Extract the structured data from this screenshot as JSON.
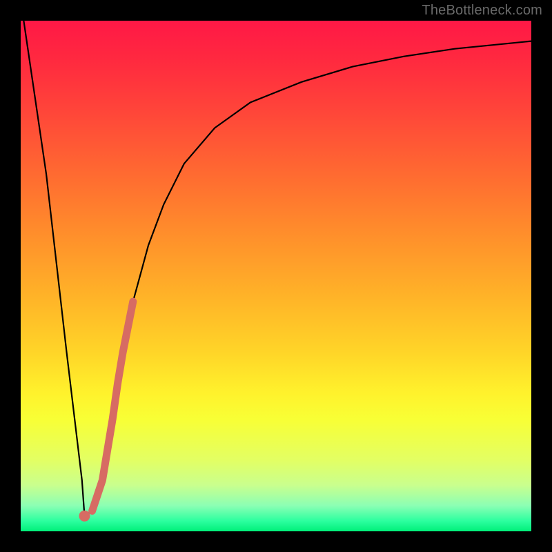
{
  "watermark": "TheBottleneck.com",
  "colors": {
    "frame": "#000000",
    "accent_segment": "#d76b63",
    "curve": "#000000"
  },
  "chart_data": {
    "type": "line",
    "title": "",
    "xlabel": "",
    "ylabel": "",
    "xlim": [
      0,
      100
    ],
    "ylim": [
      0,
      100
    ],
    "series": [
      {
        "name": "bottleneck-curve",
        "x": [
          0,
          5,
          9,
          12,
          12.5,
          14,
          16,
          18,
          20,
          22,
          25,
          28,
          32,
          38,
          45,
          55,
          65,
          75,
          85,
          95,
          100
        ],
        "y": [
          104,
          70,
          35,
          10,
          3,
          4,
          10,
          22,
          35,
          45,
          56,
          64,
          72,
          79,
          84,
          88,
          91,
          93,
          94.5,
          95.5,
          96
        ]
      }
    ],
    "highlight_segment": {
      "description": "thick salmon overlay on rising part of curve near valley",
      "x": [
        14.0,
        15.0,
        16.0,
        17.0,
        18.0,
        19.0,
        20.0,
        21.0,
        22.0
      ],
      "y": [
        4.0,
        7.0,
        10.0,
        16.0,
        22.0,
        29.0,
        35.0,
        40.0,
        45.0
      ]
    },
    "highlight_dot": {
      "x": 12.5,
      "y": 3.0
    },
    "background_gradient": {
      "top": "#ff1846",
      "mid": "#fff22c",
      "bottom": "#00ef79"
    }
  }
}
